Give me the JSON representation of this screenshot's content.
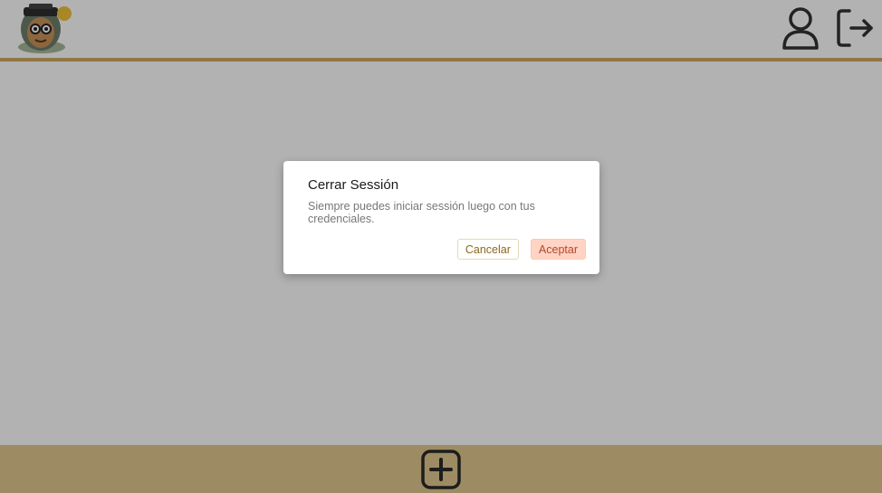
{
  "header": {
    "logo_icon": "mascot-logo-icon",
    "user_icon": "user-icon",
    "logout_icon": "logout-icon"
  },
  "footer": {
    "add_icon": "plus-square-icon"
  },
  "colors": {
    "header_rule": "#cfa964",
    "footer_bg": "#e1c98f",
    "overlay": "rgba(0,0,0,0.30)",
    "accept_bg": "#ffd4c4",
    "accept_text": "#b8442a",
    "cancel_text": "#8a6a1f"
  },
  "dialog": {
    "title": "Cerrar Sessión",
    "message": "Siempre puedes iniciar sessión luego con tus credenciales.",
    "cancel_label": "Cancelar",
    "accept_label": "Aceptar"
  }
}
